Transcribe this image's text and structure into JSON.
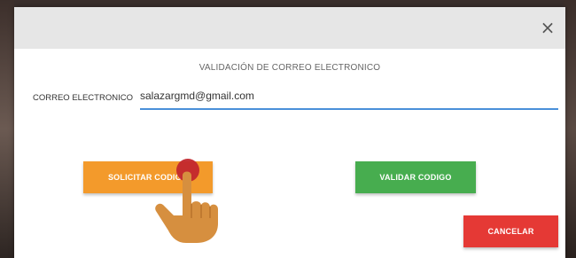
{
  "dialog": {
    "close_glyph": "×",
    "title": "VALIDACIÓN DE CORREO ELECTRONICO",
    "email": {
      "label": "CORREO ELECTRONICO",
      "value": "salazargmd@gmail.com"
    },
    "buttons": {
      "request_code": "SOLICITAR CODIGO",
      "validate_code": "VALIDAR CODIGO",
      "cancel": "CANCELAR"
    }
  },
  "colors": {
    "header_bg": "#e6e6e6",
    "request_btn": "#f39a2b",
    "validate_btn": "#47ad4f",
    "cancel_btn": "#e53935",
    "input_underline": "#4a90d9",
    "hand": "#d68f3f"
  },
  "overlay": {
    "pointer_icon": "hand-pointer-icon"
  }
}
